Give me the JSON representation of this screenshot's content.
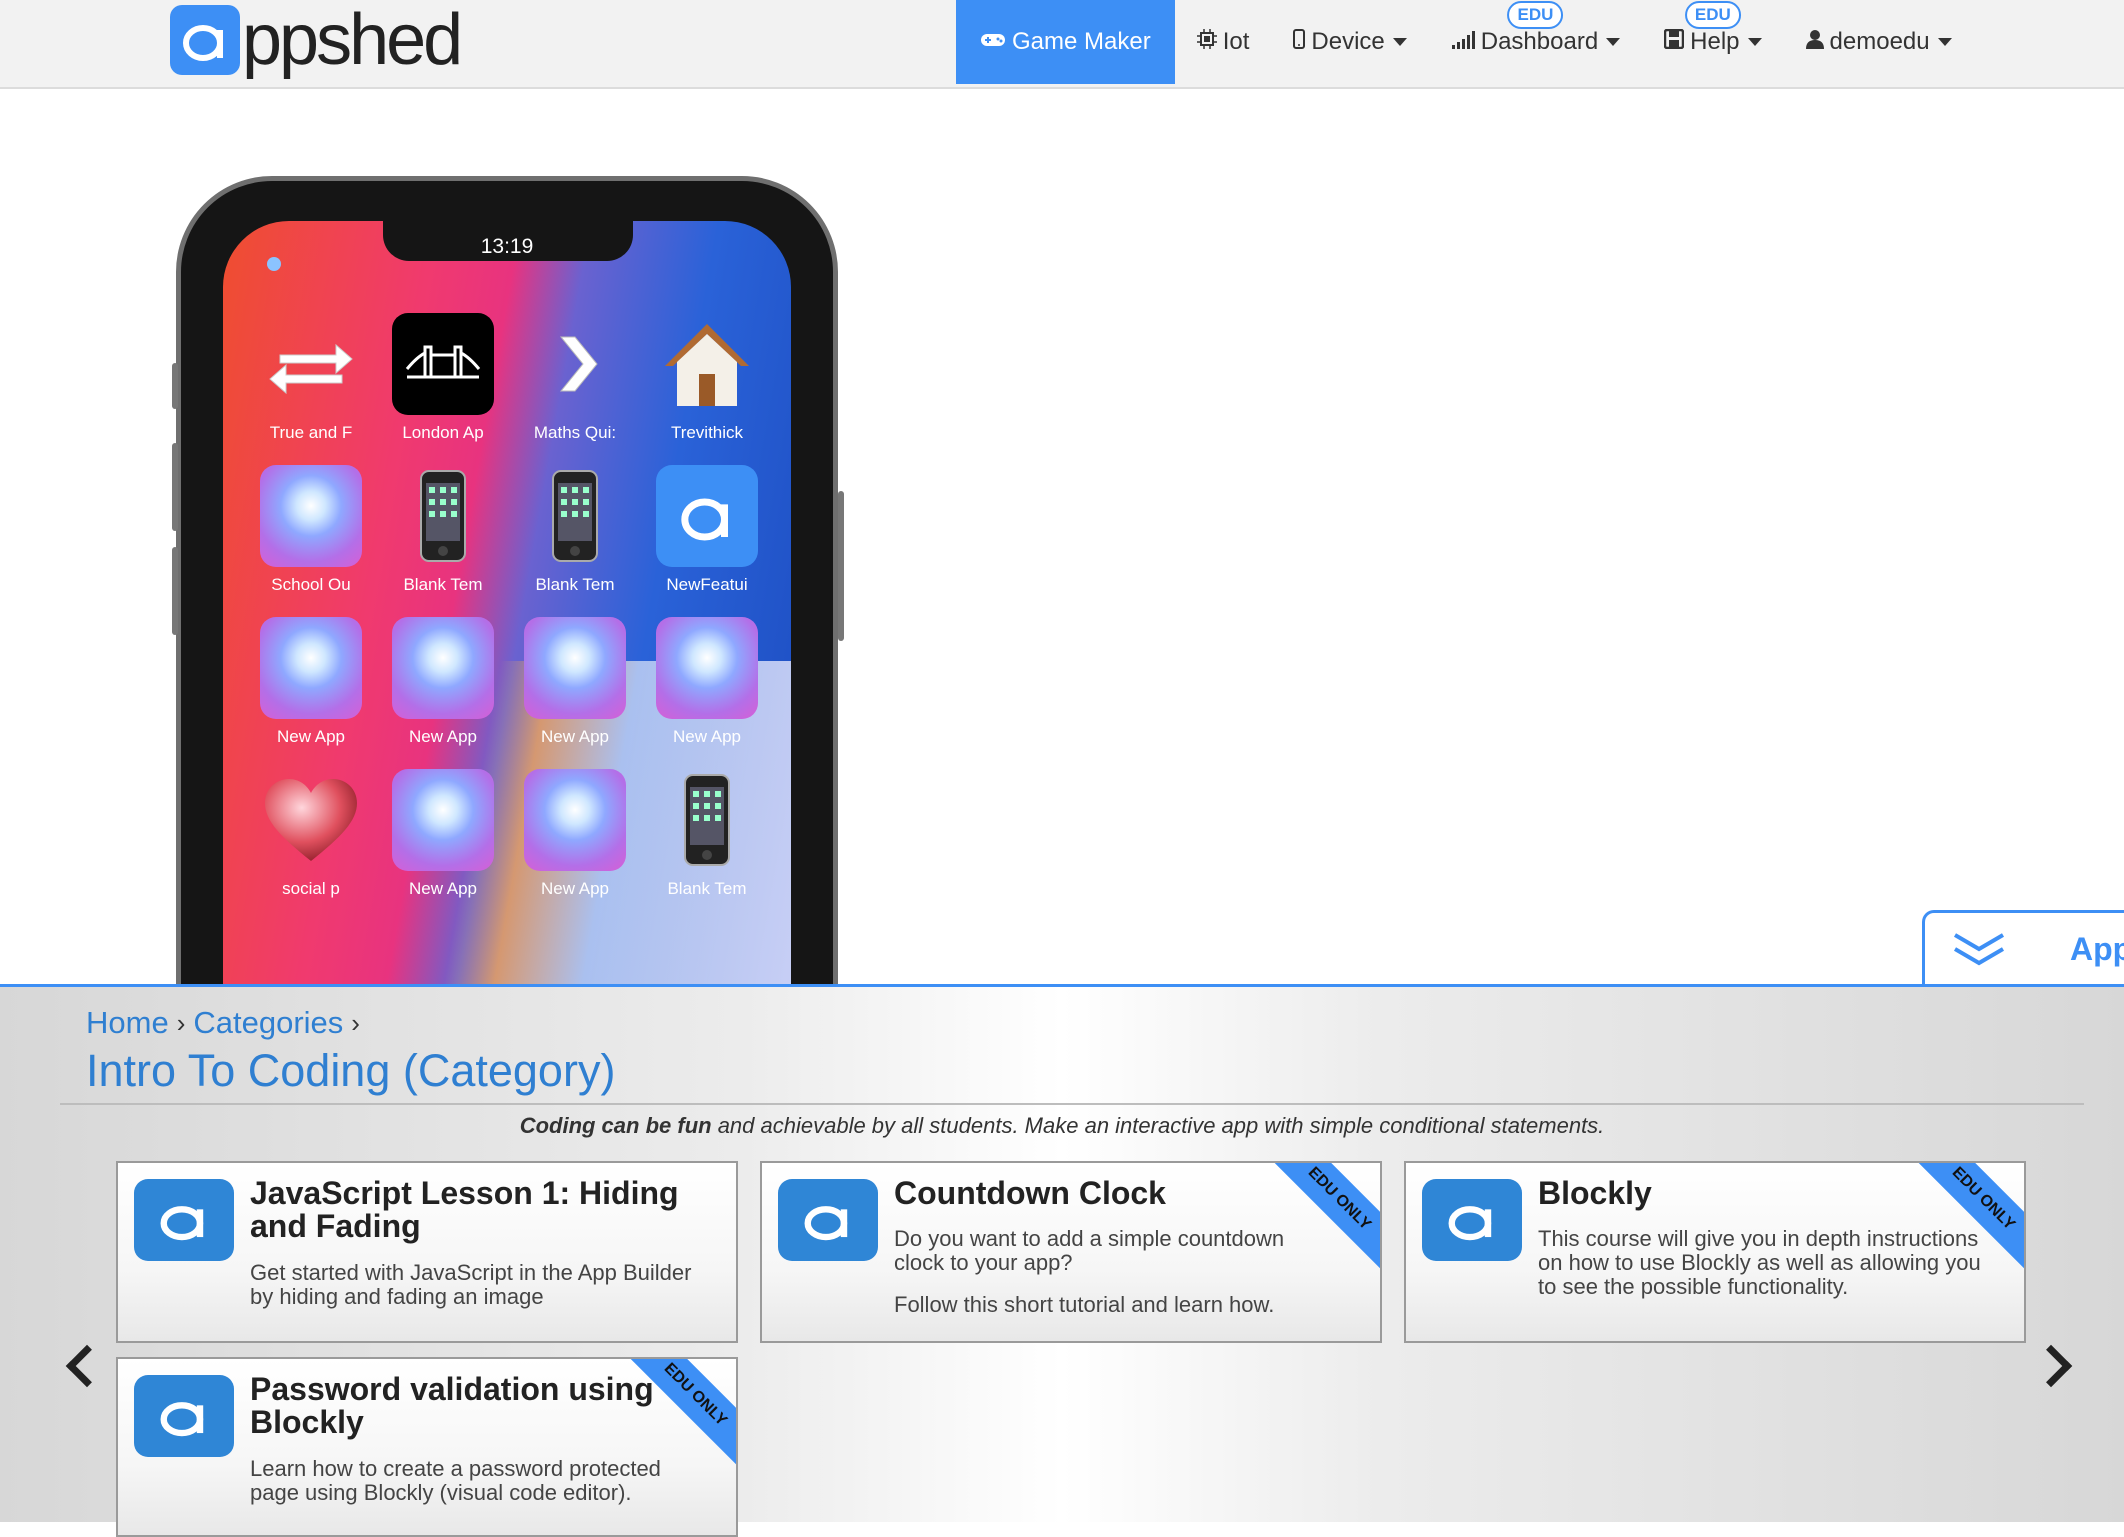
{
  "brand": {
    "logo_letter": "a",
    "logo_text": "ppshed",
    "accent": "#3d8ff5"
  },
  "nav": {
    "items": [
      {
        "label": "Game Maker",
        "icon": "gamepad-icon",
        "badge": "",
        "dropdown": false,
        "active": true
      },
      {
        "label": "Iot",
        "icon": "chip-icon",
        "badge": "",
        "dropdown": false,
        "active": false
      },
      {
        "label": "Device",
        "icon": "mobile-icon",
        "badge": "",
        "dropdown": true,
        "active": false
      },
      {
        "label": "Dashboard",
        "icon": "signal-icon",
        "badge": "EDU",
        "dropdown": true,
        "active": false
      },
      {
        "label": "Help",
        "icon": "save-icon",
        "badge": "EDU",
        "dropdown": true,
        "active": false
      },
      {
        "label": "demoedu",
        "icon": "user-icon",
        "badge": "",
        "dropdown": true,
        "active": false
      }
    ]
  },
  "phone": {
    "time": "13:19",
    "apps": [
      {
        "label": "True and F",
        "icon": "swap-arrows-icon"
      },
      {
        "label": "London Ap",
        "icon": "tower-bridge-icon"
      },
      {
        "label": "Maths Qui:",
        "icon": "chevron-right-icon"
      },
      {
        "label": "Trevithick",
        "icon": "house-icon"
      },
      {
        "label": "School Ou",
        "icon": "bokeh-icon"
      },
      {
        "label": "Blank Tem",
        "icon": "phone-icon"
      },
      {
        "label": "Blank Tem",
        "icon": "phone-icon"
      },
      {
        "label": "NewFeatui",
        "icon": "appshed-logo-icon"
      },
      {
        "label": "New App",
        "icon": "bokeh-icon"
      },
      {
        "label": "New App",
        "icon": "bokeh-icon"
      },
      {
        "label": "New App",
        "icon": "bokeh-icon"
      },
      {
        "label": "New App",
        "icon": "bokeh-icon"
      },
      {
        "label": "social p",
        "icon": "heart-icon"
      },
      {
        "label": "New App",
        "icon": "bokeh-icon"
      },
      {
        "label": "New App",
        "icon": "bokeh-icon"
      },
      {
        "label": "Blank Tem",
        "icon": "phone-icon"
      }
    ]
  },
  "float_tab": {
    "label": "App"
  },
  "breadcrumb": {
    "home": "Home",
    "categories": "Categories"
  },
  "page_title": "Intro To Coding (Category)",
  "description": {
    "bold": "Coding can be fun",
    "rest": " and achievable by all students. Make an interactive app with simple conditional statements."
  },
  "cards": [
    {
      "title": "JavaScript Lesson 1: Hiding and Fading",
      "desc": "Get started with JavaScript in the App Builder by hiding and fading an image",
      "desc2": "",
      "ribbon": ""
    },
    {
      "title": "Countdown Clock",
      "desc": "Do you want to add a simple countdown clock to your app?",
      "desc2": "Follow this short tutorial and learn how.",
      "ribbon": "EDU ONLY"
    },
    {
      "title": "Blockly",
      "desc": "This course will give you in depth instructions on how to use Blockly as well as allowing you to see the possible functionality.",
      "desc2": "",
      "ribbon": "EDU ONLY"
    },
    {
      "title": "Password validation using Blockly",
      "desc": "Learn how to create a password protected page using Blockly (visual code editor).",
      "desc2": "",
      "ribbon": "EDU ONLY"
    }
  ]
}
